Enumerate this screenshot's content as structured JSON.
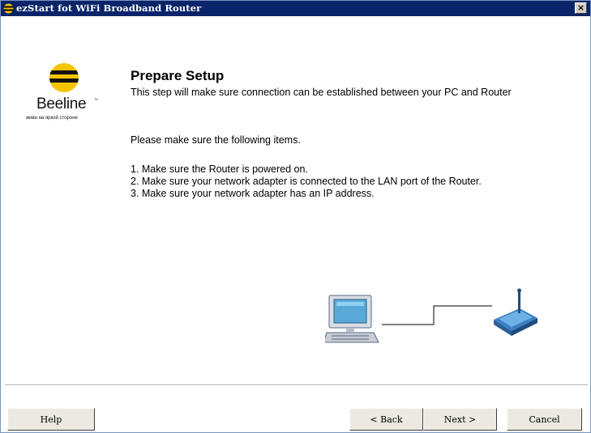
{
  "window": {
    "title": "ezStart fot WiFi Broadband Router",
    "close_label": "×"
  },
  "logo": {
    "brand": "Beeline",
    "tm": "™",
    "tagline": "живи на яркой стороне"
  },
  "content": {
    "heading": "Prepare Setup",
    "subheading": "This step will make sure connection can be established between your PC and Router",
    "intro": "Please make sure the following items.",
    "steps": [
      "1. Make sure the Router is powered on.",
      "2. Make sure your network adapter is connected to the LAN port of the Router.",
      "3. Make sure your network adapter has an IP address."
    ]
  },
  "diagram": {
    "left_icon": "computer-icon",
    "right_icon": "router-icon"
  },
  "buttons": {
    "help": "Help",
    "back": "< Back",
    "next": "Next >",
    "cancel": "Cancel"
  },
  "colors": {
    "titlebar": "#0a246a",
    "brand_yellow": "#f5c400",
    "button_face": "#ece9e2"
  }
}
